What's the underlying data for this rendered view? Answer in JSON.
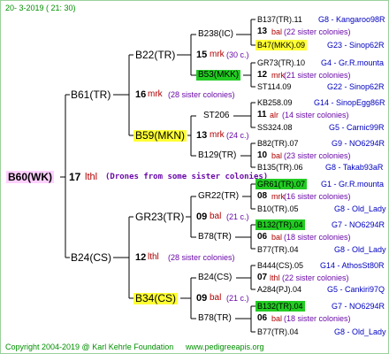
{
  "header": {
    "date": "20-  3-2019  (  21:  30)"
  },
  "footer": {
    "copyright": "Copyright 2004-2019 @ Karl Kehrle Foundation",
    "url": "www.pedigreeapis.org"
  },
  "root": {
    "label": "B60(WK)",
    "gen": "17",
    "mark": "lthl",
    "note": "(Drones from some sister colonies)"
  },
  "gen1": [
    {
      "label": "B61(TR)",
      "gen": "16",
      "mark": "mrk",
      "note": "(28 sister colonies)"
    },
    {
      "label": "B24(CS)",
      "gen": "12",
      "mark": "lthl",
      "note": "(28 sister colonies)"
    }
  ],
  "gen2": [
    {
      "label": "B22(TR)",
      "gen": "15",
      "mark": "mrk",
      "note": "(30 c.)"
    },
    {
      "label": "B59(MKN)",
      "gen": "13",
      "mark": "mrk",
      "note": "(24 c.)"
    },
    {
      "label": "GR23(TR)",
      "gen": "09",
      "mark": "bal",
      "note": "(21 c.)"
    },
    {
      "label": "B34(CS)",
      "gen": "09",
      "mark": "bal",
      "note": "(21 c.)"
    }
  ],
  "gen3": [
    {
      "label": "B238(IC)"
    },
    {
      "label": "B53(MKK)"
    },
    {
      "label": "ST206"
    },
    {
      "label": "B129(TR)"
    },
    {
      "label": "GR22(TR)"
    },
    {
      "label": "B78(TR)"
    },
    {
      "label": "B24(CS)"
    },
    {
      "label": "B78(TR)"
    }
  ],
  "gen4": [
    {
      "name": "B137(TR).11",
      "code": "G8 - Kangaroo98R"
    },
    {
      "gen": "13",
      "mark": "bal",
      "note": "(22 sister colonies)"
    },
    {
      "name": "B47(MKK).09",
      "code": "G23 - Sinop62R"
    },
    {
      "name": "GR73(TR).10",
      "code": "G4 - Gr.R.mounta"
    },
    {
      "gen": "12",
      "mark": "mrk",
      "note": "(21 sister colonies)"
    },
    {
      "name": "ST114.09",
      "code": "G22 - Sinop62R"
    },
    {
      "name": "KB258.09",
      "code": "G14 - SinopEgg86R"
    },
    {
      "gen": "11",
      "mark": "alr",
      "note": "(14 sister colonies)"
    },
    {
      "name": "SS324.08",
      "code": "G5 - Carnic99R"
    },
    {
      "name": "B82(TR).07",
      "code": "G9 - NO6294R"
    },
    {
      "gen": "10",
      "mark": "bal",
      "note": "(23 sister colonies)"
    },
    {
      "name": "B135(TR).06",
      "code": "G8 - Takab93aR"
    },
    {
      "name": "GR61(TR).07",
      "code": "G1 - Gr.R.mounta"
    },
    {
      "gen": "08",
      "mark": "mrk",
      "note": "(16 sister colonies)"
    },
    {
      "name": "B10(TR).05",
      "code": "G8 - Old_Lady"
    },
    {
      "name": "B132(TR).04",
      "code": "G7 - NO6294R"
    },
    {
      "gen": "06",
      "mark": "bal",
      "note": "(18 sister colonies)"
    },
    {
      "name": "B77(TR).04",
      "code": "G8 - Old_Lady"
    },
    {
      "name": "B444(CS).05",
      "code": "G14 - AthosSt80R"
    },
    {
      "gen": "07",
      "mark": "lthl",
      "note": "(22 sister colonies)"
    },
    {
      "name": "A284(PJ).04",
      "code": "G5 - Cankiri97Q"
    },
    {
      "name": "B132(TR).04",
      "code": "G7 - NO6294R"
    },
    {
      "gen": "06",
      "mark": "bal",
      "note": "(18 sister colonies)"
    },
    {
      "name": "B77(TR).04",
      "code": "G8 - Old_Lady"
    }
  ]
}
